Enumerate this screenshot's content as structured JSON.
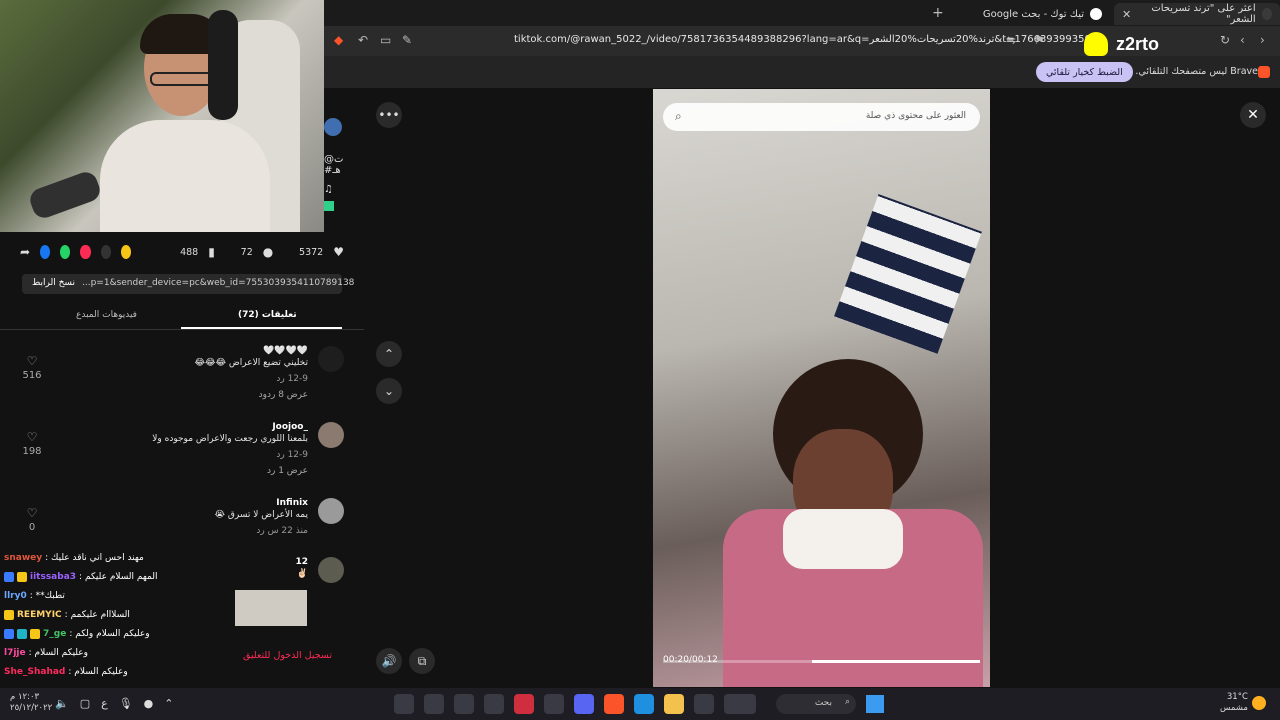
{
  "browser": {
    "tabs": [
      {
        "label": "اعثر على \"ترند تسريحات الشعر\"",
        "active": true
      },
      {
        "label": "تيك توك - بحث Google",
        "active": false
      }
    ],
    "url": "tiktok.com/@rawan_5022_/video/7581736354489388296?lang=ar&q=ترند%20تسريحات%20الشعر&t=1766393993500",
    "infobar_text": "Brave ليس متصفحك التلقائي.",
    "infobar_button": "الضبط كخيار تلقائي"
  },
  "streamer": {
    "snap_name": "z2rto"
  },
  "video_panel": {
    "actions": {
      "likes": "5372",
      "comments": "72",
      "saves": "488"
    },
    "copy_link_label": "نسخ الرابط",
    "share_link": "...p=1&sender_device=pc&web_id=7553039354110789138",
    "tabs": {
      "comments": "(72) تعليقات",
      "creator_videos": "فيديوهات المبدع"
    },
    "side_handle": "@ت",
    "side_tag": "#هـ",
    "login_prompt": "تسجيل الدخول للتعليق"
  },
  "comments": [
    {
      "name": "🤍🤍🤍🤍",
      "text": "تخليني تضيع الاعراض 😂😂😂",
      "meta": "12-9   رد",
      "replies": "عرض 8 ردود",
      "likes": "516"
    },
    {
      "name": "Joojoo_",
      "text": "بلمعنا اللوري رجعت والاعراض موجوده ولا",
      "meta": "12-9   رد",
      "replies": "عرض 1 رد",
      "likes": "198"
    },
    {
      "name": "Infinix",
      "text": "يمه الأعراض لا تسرق 😭",
      "meta": "منذ 22 س   رد",
      "replies": "",
      "likes": "0"
    },
    {
      "name": "12",
      "text": "✌🏻",
      "meta": "",
      "replies": "",
      "likes": ""
    }
  ],
  "chat": [
    {
      "user": "snawey",
      "color": "#e0573b",
      "msg": ": مهند احس اني ناقد عليك"
    },
    {
      "user": "iitssaba3",
      "color": "#9b62ff",
      "msg": ": المهم السلام عليكم"
    },
    {
      "user": "llry0",
      "color": "#6aa7ff",
      "msg": ": **تطبك"
    },
    {
      "user": "REEMYIC",
      "color": "#ffd36a",
      "msg": ": السلااام عليكمم"
    },
    {
      "user": "7_ge",
      "color": "#43c463",
      "msg": ": وعليكم السلام ولكم"
    },
    {
      "user": "l7jje",
      "color": "#ff4aa0",
      "msg": ": وعليكم السلام"
    },
    {
      "user": "She_Shahad",
      "color": "#ff2b5e",
      "msg": ": وعليكم السلام"
    }
  ],
  "video": {
    "search_placeholder": "العثور على محتوى ذي صلة",
    "time": "00:20/00:12",
    "progress": 0.53
  },
  "taskbar": {
    "time": "١٢:٠٣ م",
    "date": "٢٥/١٢/٢٠٢٢",
    "search_label": "بحث",
    "weather_temp": "31°C",
    "weather_desc": "مشمس",
    "lang": "ع"
  },
  "colors": {
    "tiktok_red": "#fe2c55",
    "snap_yellow": "#fffc00",
    "brave_orange": "#fb542b"
  }
}
